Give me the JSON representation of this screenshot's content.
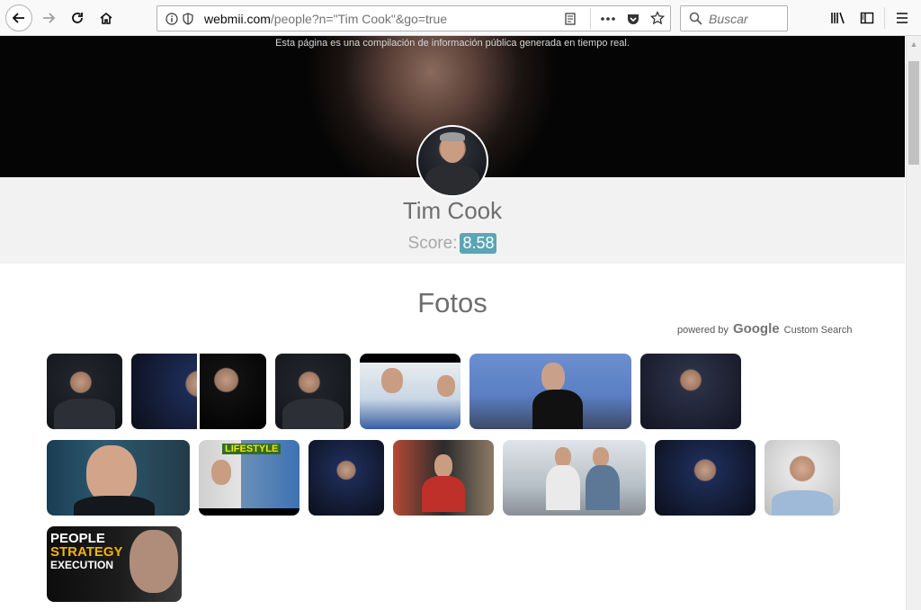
{
  "browser": {
    "url_host": "webmii.com",
    "url_path": "/people?n=\"Tim Cook\"&go=true",
    "search_placeholder": "Buscar",
    "icons": [
      "back-icon",
      "forward-icon",
      "reload-icon",
      "home-icon",
      "info-icon",
      "shield-icon",
      "reader-view-icon",
      "more-icon",
      "pocket-icon",
      "bookmark-star-icon",
      "search-icon",
      "library-icon",
      "sidebar-icon",
      "menu-icon"
    ]
  },
  "banner": {
    "note": "Esta página es una compilación de información pública generada en tiempo real."
  },
  "profile": {
    "name": "Tim Cook",
    "score_label": "Score:",
    "score_value": "8.58"
  },
  "photos_section": {
    "title": "Fotos",
    "powered_by": "powered by",
    "google": "Google",
    "custom_search": "Custom Search",
    "thumb_overlays": {
      "lifestyle": "LIFESTYLE",
      "people_line1": "PEOPLE",
      "people_line2": "STRATEGY",
      "people_line3": "EXECUTION"
    }
  },
  "colors": {
    "score_badge": "#5ba5b5",
    "profile_band": "#f2f2f2",
    "toolbar": "#f9f9fa"
  }
}
